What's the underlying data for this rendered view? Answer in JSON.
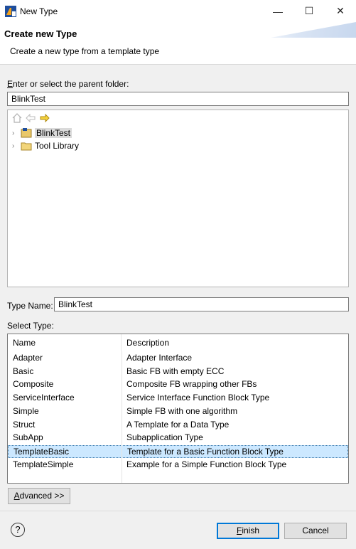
{
  "window": {
    "title": "New Type",
    "minimize": "—",
    "maximize": "☐",
    "close": "✕"
  },
  "banner": {
    "title": "Create new Type",
    "message": "Create a new type from a template type"
  },
  "parent_folder": {
    "label": "Enter or select the parent folder:",
    "value": "BlinkTest"
  },
  "tree": {
    "items": [
      {
        "label": "BlinkTest",
        "icon": "project-icon",
        "selected": true
      },
      {
        "label": "Tool Library",
        "icon": "folder-icon",
        "selected": false
      }
    ]
  },
  "type_name": {
    "label": "Type Name:",
    "value": "BlinkTest"
  },
  "select_type": {
    "label": "Select Type:",
    "columns": [
      "Name",
      "Description"
    ],
    "rows": [
      {
        "name": "Adapter",
        "description": "Adapter Interface"
      },
      {
        "name": "Basic",
        "description": "Basic FB with empty ECC"
      },
      {
        "name": "Composite",
        "description": "Composite FB wrapping other FBs"
      },
      {
        "name": "ServiceInterface",
        "description": "Service Interface Function Block Type"
      },
      {
        "name": "Simple",
        "description": "Simple FB with one algorithm"
      },
      {
        "name": "Struct",
        "description": "A Template for a Data Type"
      },
      {
        "name": "SubApp",
        "description": "Subapplication Type"
      },
      {
        "name": "TemplateBasic",
        "description": "Template for a Basic Function Block Type"
      },
      {
        "name": "TemplateSimple",
        "description": "Example for a Simple Function Block Type"
      }
    ],
    "selected_index": 7
  },
  "buttons": {
    "advanced": "Advanced >>",
    "finish": "Finish",
    "cancel": "Cancel",
    "help": "?"
  }
}
